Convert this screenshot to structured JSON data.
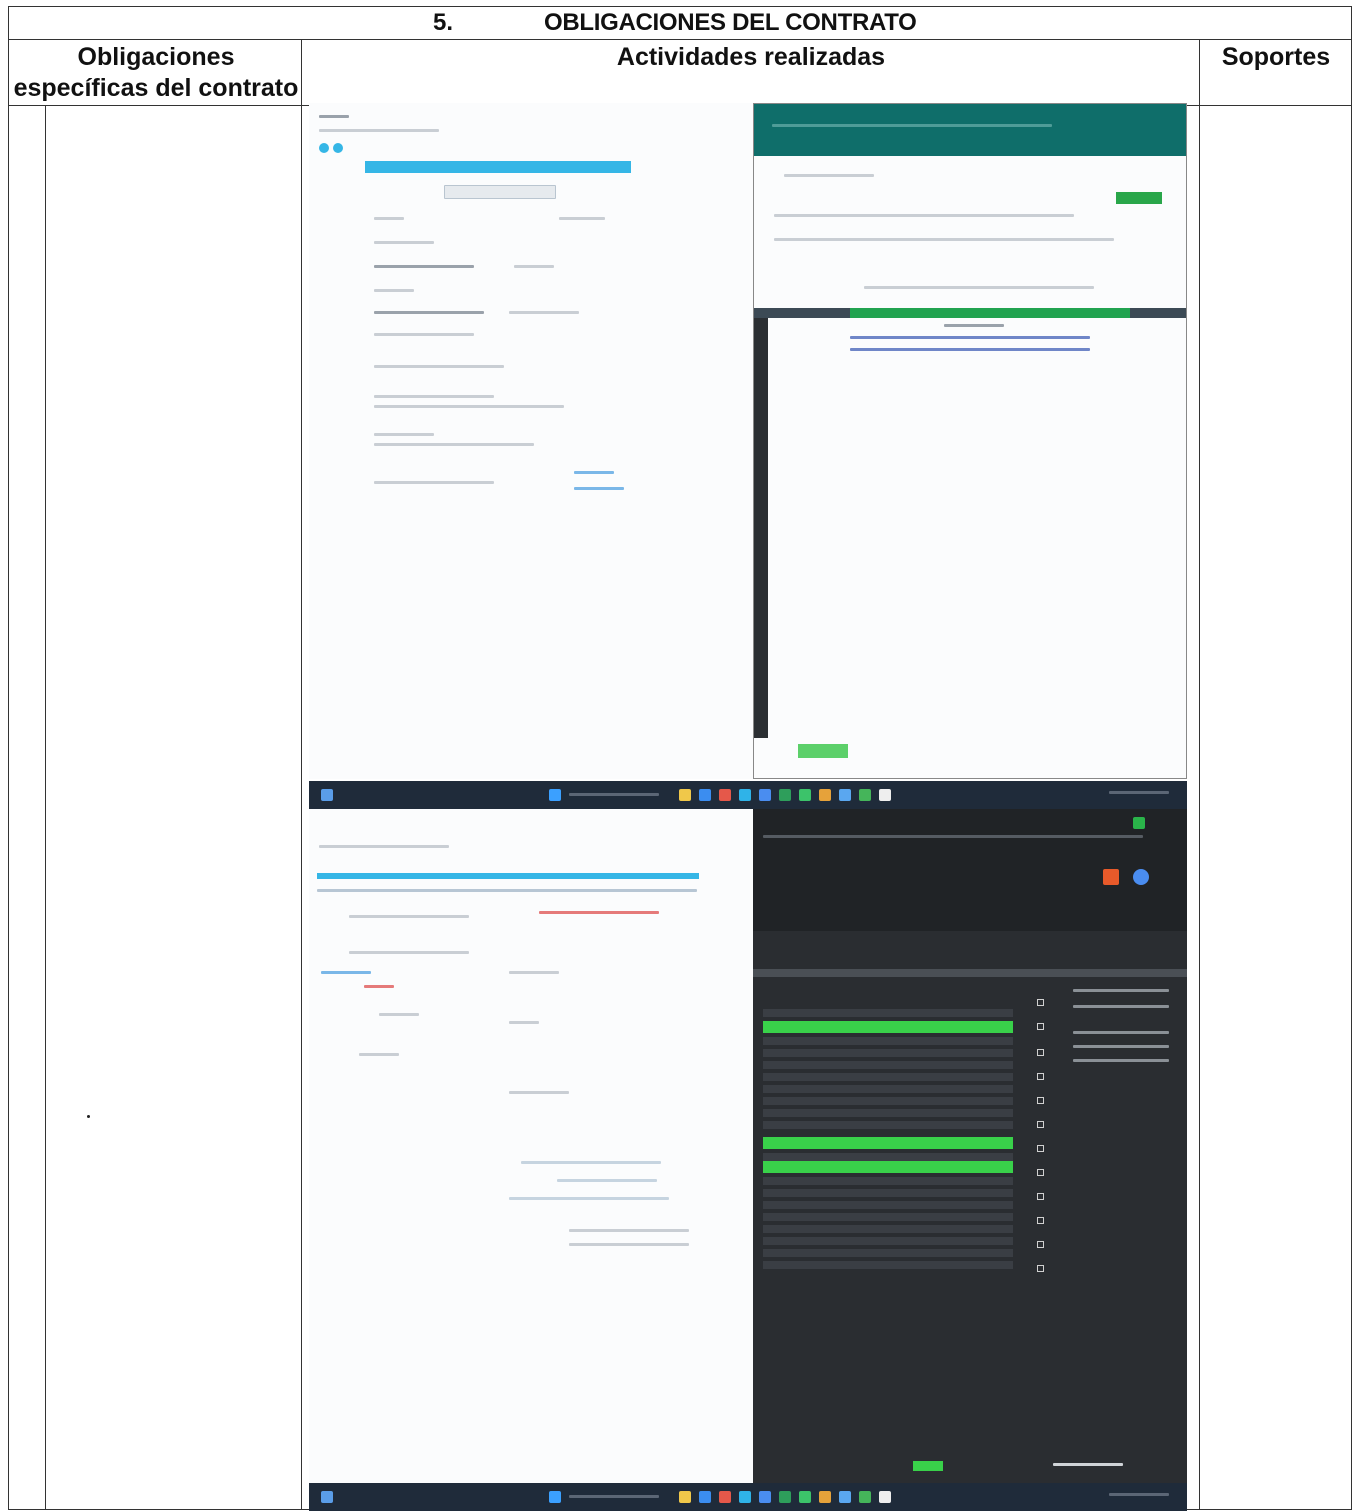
{
  "section": {
    "number": "5.",
    "title": "OBLIGACIONES DEL CONTRATO"
  },
  "columns": {
    "obligaciones": "Obligaciones específicas del contrato",
    "actividades": "Actividades realizadas",
    "soportes": "Soportes"
  },
  "colors": {
    "border": "#333333",
    "excel_green": "#39d14a",
    "accent_cyan": "#35b6e6",
    "browser_teal": "#0f6e6a",
    "taskbar": "#1f2b3a",
    "excel_dark": "#2a2d31"
  }
}
